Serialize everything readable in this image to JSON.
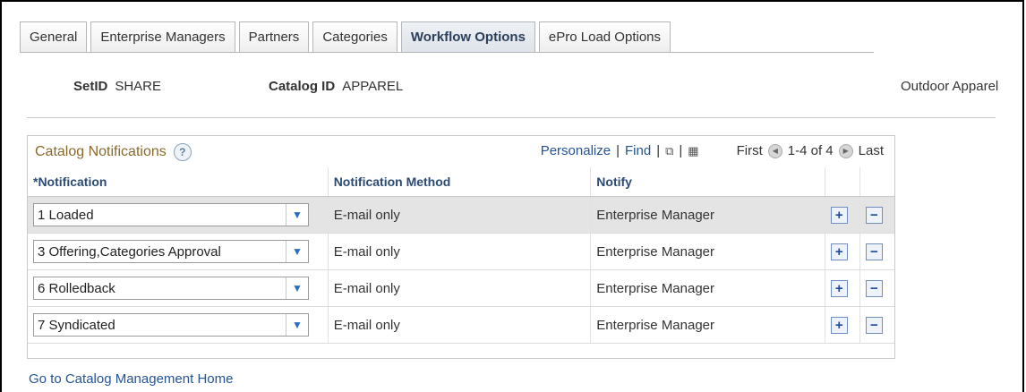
{
  "tabs": [
    {
      "label": "General",
      "active": false
    },
    {
      "label": "Enterprise Managers",
      "active": false
    },
    {
      "label": "Partners",
      "active": false
    },
    {
      "label": "Categories",
      "active": false
    },
    {
      "label": "Workflow Options",
      "active": true
    },
    {
      "label": "ePro Load Options",
      "active": false
    }
  ],
  "header": {
    "setid_label": "SetID",
    "setid_value": "SHARE",
    "catalog_label": "Catalog ID",
    "catalog_value": "APPAREL",
    "catalog_desc": "Outdoor Apparel"
  },
  "grid": {
    "title": "Catalog Notifications",
    "help": "?",
    "personalize": "Personalize",
    "find": "Find",
    "first": "First",
    "range": "1-4 of 4",
    "last": "Last",
    "columns": [
      "*Notification",
      "Notification Method",
      "Notify"
    ],
    "rows": [
      {
        "notification": "1 Loaded",
        "method": "E-mail only",
        "notify": "Enterprise Manager"
      },
      {
        "notification": "3 Offering,Categories Approval",
        "method": "E-mail only",
        "notify": "Enterprise Manager"
      },
      {
        "notification": "6 Rolledback",
        "method": "E-mail only",
        "notify": "Enterprise Manager"
      },
      {
        "notification": "7 Syndicated",
        "method": "E-mail only",
        "notify": "Enterprise Manager"
      }
    ]
  },
  "footer_link": "Go to Catalog Management Home",
  "colors": {
    "link": "#255496",
    "grid_title": "#8a6a2a",
    "header_text": "#2b4b74"
  }
}
